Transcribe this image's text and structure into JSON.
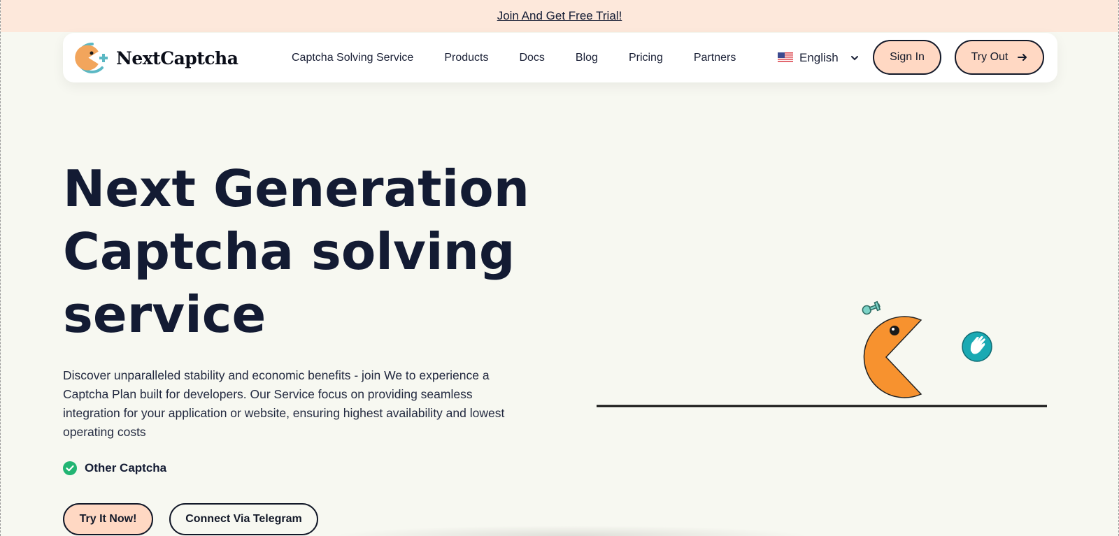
{
  "promo": {
    "link_text": "Join And Get Free Trial!"
  },
  "brand": {
    "name": "NextCaptcha"
  },
  "nav": {
    "items": [
      {
        "label": "Captcha Solving Service"
      },
      {
        "label": "Products"
      },
      {
        "label": "Docs"
      },
      {
        "label": "Blog"
      },
      {
        "label": "Pricing"
      },
      {
        "label": "Partners"
      }
    ],
    "language": "English",
    "sign_in": "Sign In",
    "try_out": "Try Out"
  },
  "hero": {
    "title_line1": "Next Generation",
    "title_line2": "Captcha solving",
    "title_line3": "service",
    "description": "Discover unparalleled stability and economic benefits - join We to experience a Captcha Plan built for developers. Our Service focus on providing seamless integration for your application or website, ensuring highest availability and lowest operating costs",
    "feature": "Other Captcha",
    "cta_primary": "Try It Now!",
    "cta_secondary": "Connect Via Telegram"
  },
  "colors": {
    "background": "#f7f8f1",
    "promo_bg": "#fde8db",
    "accent_peach": "#ffd8c3",
    "navy": "#131b33",
    "orange": "#f7922f",
    "teal": "#1aa9b3",
    "green_check": "#22b573"
  },
  "icons": [
    "logo-pacman-icon",
    "us-flag-icon",
    "chevron-down-icon",
    "arrow-right-icon",
    "check-circle-icon",
    "pacman-icon",
    "hand-ball-icon"
  ]
}
